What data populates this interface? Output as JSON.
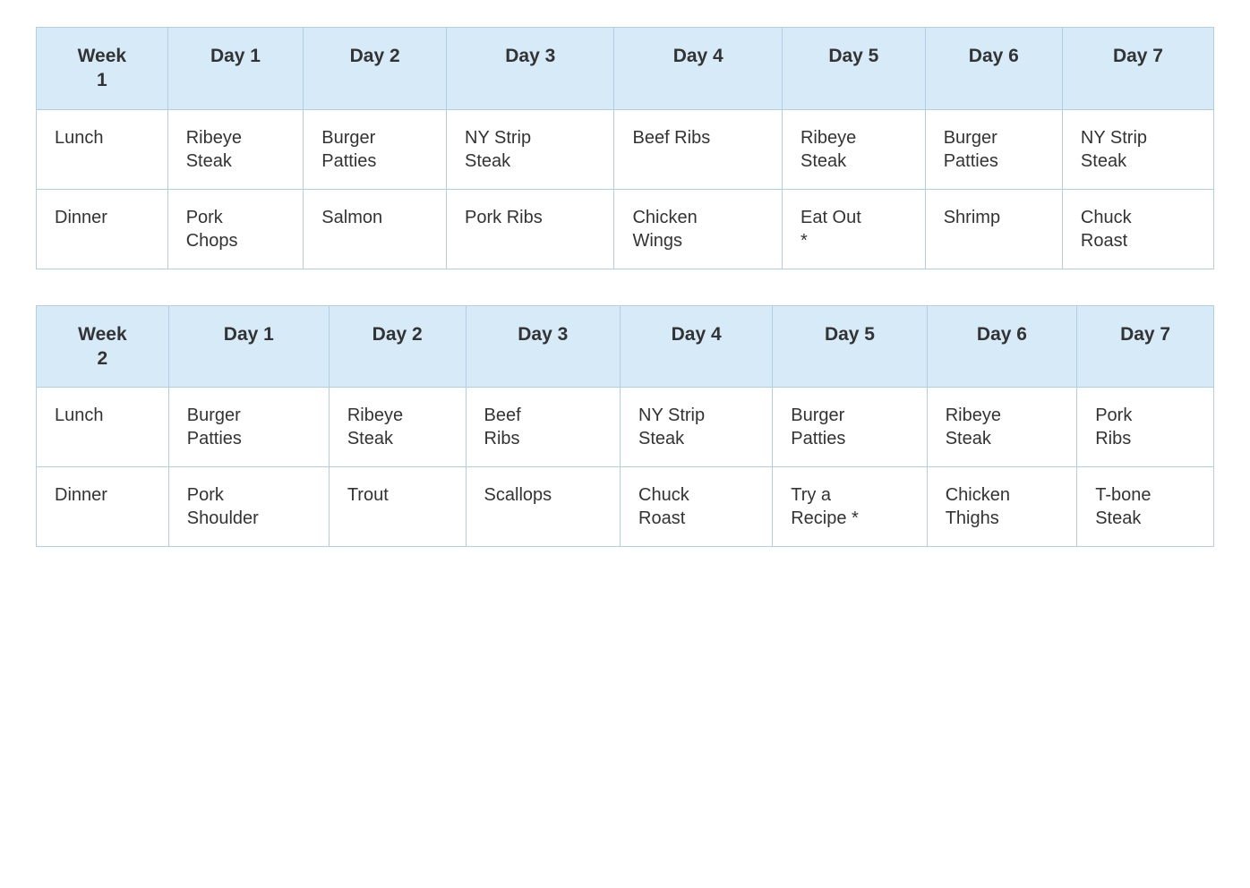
{
  "week1": {
    "headers": {
      "week": "Week\n1",
      "day1": "Day 1",
      "day2": "Day 2",
      "day3": "Day 3",
      "day4": "Day 4",
      "day5": "Day 5",
      "day6": "Day 6",
      "day7": "Day 7"
    },
    "lunch": {
      "label": "Lunch",
      "day1": "Ribeye\nSteak",
      "day2": "Burger\nPatties",
      "day3": "NY Strip\nSteak",
      "day4": "Beef Ribs",
      "day5": "Ribeye\nSteak",
      "day6": "Burger\nPatties",
      "day7": "NY Strip\nSteak"
    },
    "dinner": {
      "label": "Dinner",
      "day1": "Pork\nChops",
      "day2": "Salmon",
      "day3": "Pork Ribs",
      "day4": "Chicken\nWings",
      "day5": "Eat Out\n*",
      "day6": "Shrimp",
      "day7": "Chuck\nRoast"
    }
  },
  "week2": {
    "headers": {
      "week": "Week\n2",
      "day1": "Day 1",
      "day2": "Day 2",
      "day3": "Day 3",
      "day4": "Day 4",
      "day5": "Day 5",
      "day6": "Day 6",
      "day7": "Day 7"
    },
    "lunch": {
      "label": "Lunch",
      "day1": "Burger\nPatties",
      "day2": "Ribeye\nSteak",
      "day3": "Beef\nRibs",
      "day4": "NY Strip\nSteak",
      "day5": "Burger\nPatties",
      "day6": "Ribeye\nSteak",
      "day7": "Pork\nRibs"
    },
    "dinner": {
      "label": "Dinner",
      "day1": "Pork\nShoulder",
      "day2": "Trout",
      "day3": "Scallops",
      "day4": "Chuck\nRoast",
      "day5": "Try a\nRecipe *",
      "day6": "Chicken\nThighs",
      "day7": "T-bone\nSteak"
    }
  }
}
